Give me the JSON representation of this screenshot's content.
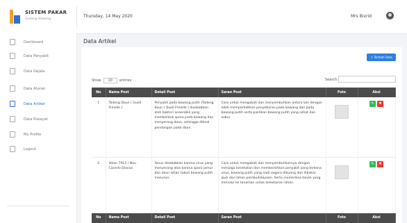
{
  "brand": {
    "title": "SISTEM PAKAR",
    "subtitle": "Gudang Bawang"
  },
  "header": {
    "date": "Thursday, 14 May 2020",
    "user": "Mrs Bivrid"
  },
  "sidebar": {
    "items": [
      {
        "label": "Dashboard",
        "icon": "home-icon"
      },
      {
        "label": "Data Penyakit",
        "icon": "clipboard-icon"
      },
      {
        "label": "Data Gejala",
        "icon": "list-icon"
      },
      {
        "label": "Data Aturan",
        "icon": "rules-icon"
      },
      {
        "label": "Data Artikel",
        "icon": "article-icon",
        "active": true
      },
      {
        "label": "Data Riwayat",
        "icon": "history-icon"
      },
      {
        "label": "My Profile",
        "icon": "user-icon"
      },
      {
        "label": "Logout",
        "icon": "logout-icon"
      }
    ]
  },
  "main": {
    "title": "Data Artikel",
    "add_button": "+ Tambah Data",
    "show_label": "Show",
    "show_value": "10",
    "entries_label": "entries",
    "search_label": "Search:"
  },
  "table": {
    "headers": [
      "No",
      "Nama Post",
      "Detail Post",
      "Saran Post",
      "Foto",
      "Aksi"
    ],
    "rows": [
      {
        "no": "1",
        "nama": "Tadeng Daun ( Guell Frinelle )",
        "detail": "Penyakit pada bawang putih (Tadeng daun ( Quell Frinelle ) disebabkan oleh bakteri anaerobik yang membentuk spora pada bawang dan menyerang daun, sehingga ditinal pendangan pada daun.",
        "saran": "Cara untuk mengobati dan menyembuhkan antara lain dengan lebih memperhatikan penyebaran pada bawang dan pada bawang putih serta pastikan bawang putih yang sehat dan subur."
      },
      {
        "no": "2",
        "nama": "Volan 7912 / Nau Cacerlo Diacoa",
        "detail": "Yaxus disebabkan karena virus yang menyerang atas karena spora jamur dan daun lahan tubuh bawang putih menurun.",
        "saran": "Cara untuk mengobati dan menyembuhkannya dengan menjaga kesehatan dan membersihkan penyakit yang terkena virus, bawang putih yang mati segera dibuang dan dibakar jauh dari lahan pembudidayaan. Serta memeriksa tanah yang menular ke tanaman untuk kelestarian lahan."
      }
    ],
    "edit_icon": "edit-icon",
    "delete_icon": "trash-icon"
  },
  "colors": {
    "primary": "#2f7fe0",
    "header_row": "#4b4b4b",
    "edit": "#2ebd59",
    "delete": "#e8382f",
    "logo_orange": "#f0a22b",
    "logo_blue": "#2f6fd1"
  }
}
